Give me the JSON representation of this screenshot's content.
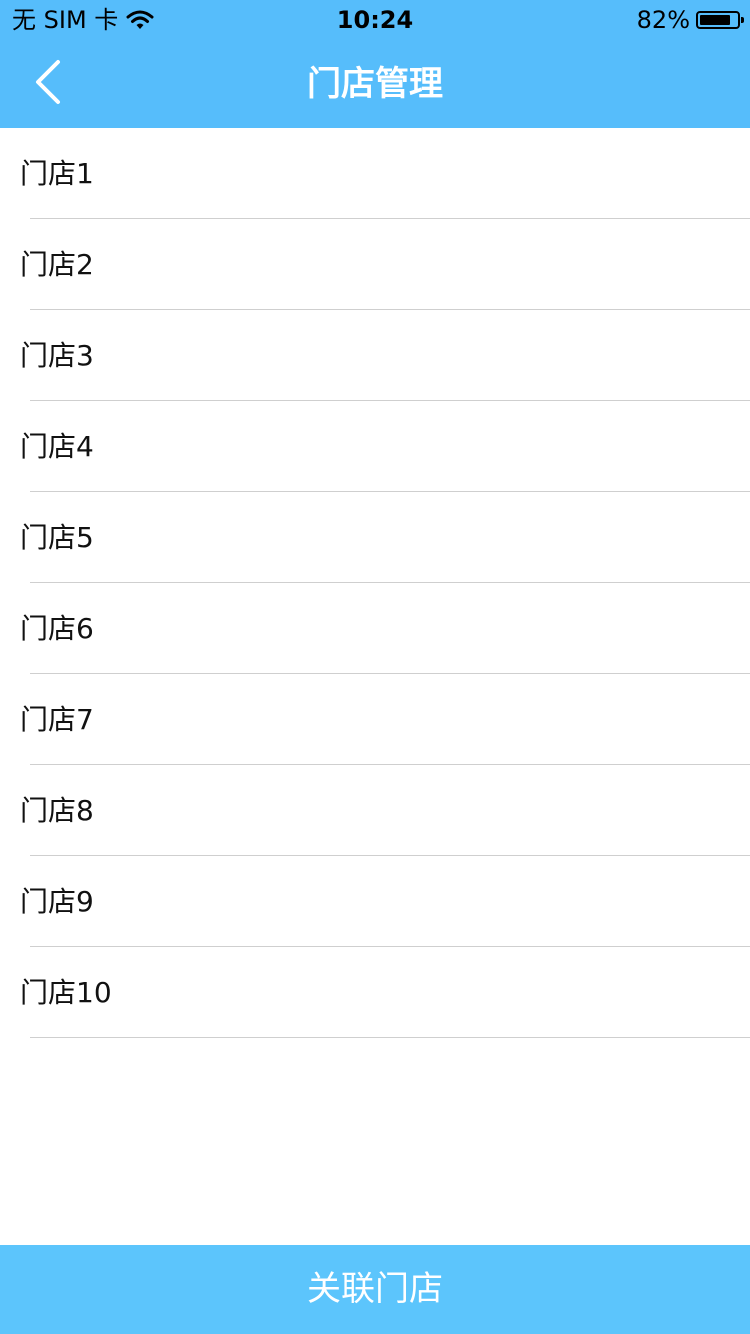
{
  "status_bar": {
    "carrier": "无 SIM 卡",
    "time": "10:24",
    "battery_percent": "82%",
    "battery_level": 0.82,
    "wifi_icon": "wifi-icon"
  },
  "nav": {
    "back_icon": "chevron-left-icon",
    "title": "门店管理"
  },
  "stores": [
    {
      "label": "门店1"
    },
    {
      "label": "门店2"
    },
    {
      "label": "门店3"
    },
    {
      "label": "门店4"
    },
    {
      "label": "门店5"
    },
    {
      "label": "门店6"
    },
    {
      "label": "门店7"
    },
    {
      "label": "门店8"
    },
    {
      "label": "门店9"
    },
    {
      "label": "门店10"
    }
  ],
  "footer": {
    "button_label": "关联门店"
  },
  "colors": {
    "nav_bg": "#56bdfb",
    "button_bg": "#5cc5fc",
    "divider": "#cfcfcf"
  }
}
